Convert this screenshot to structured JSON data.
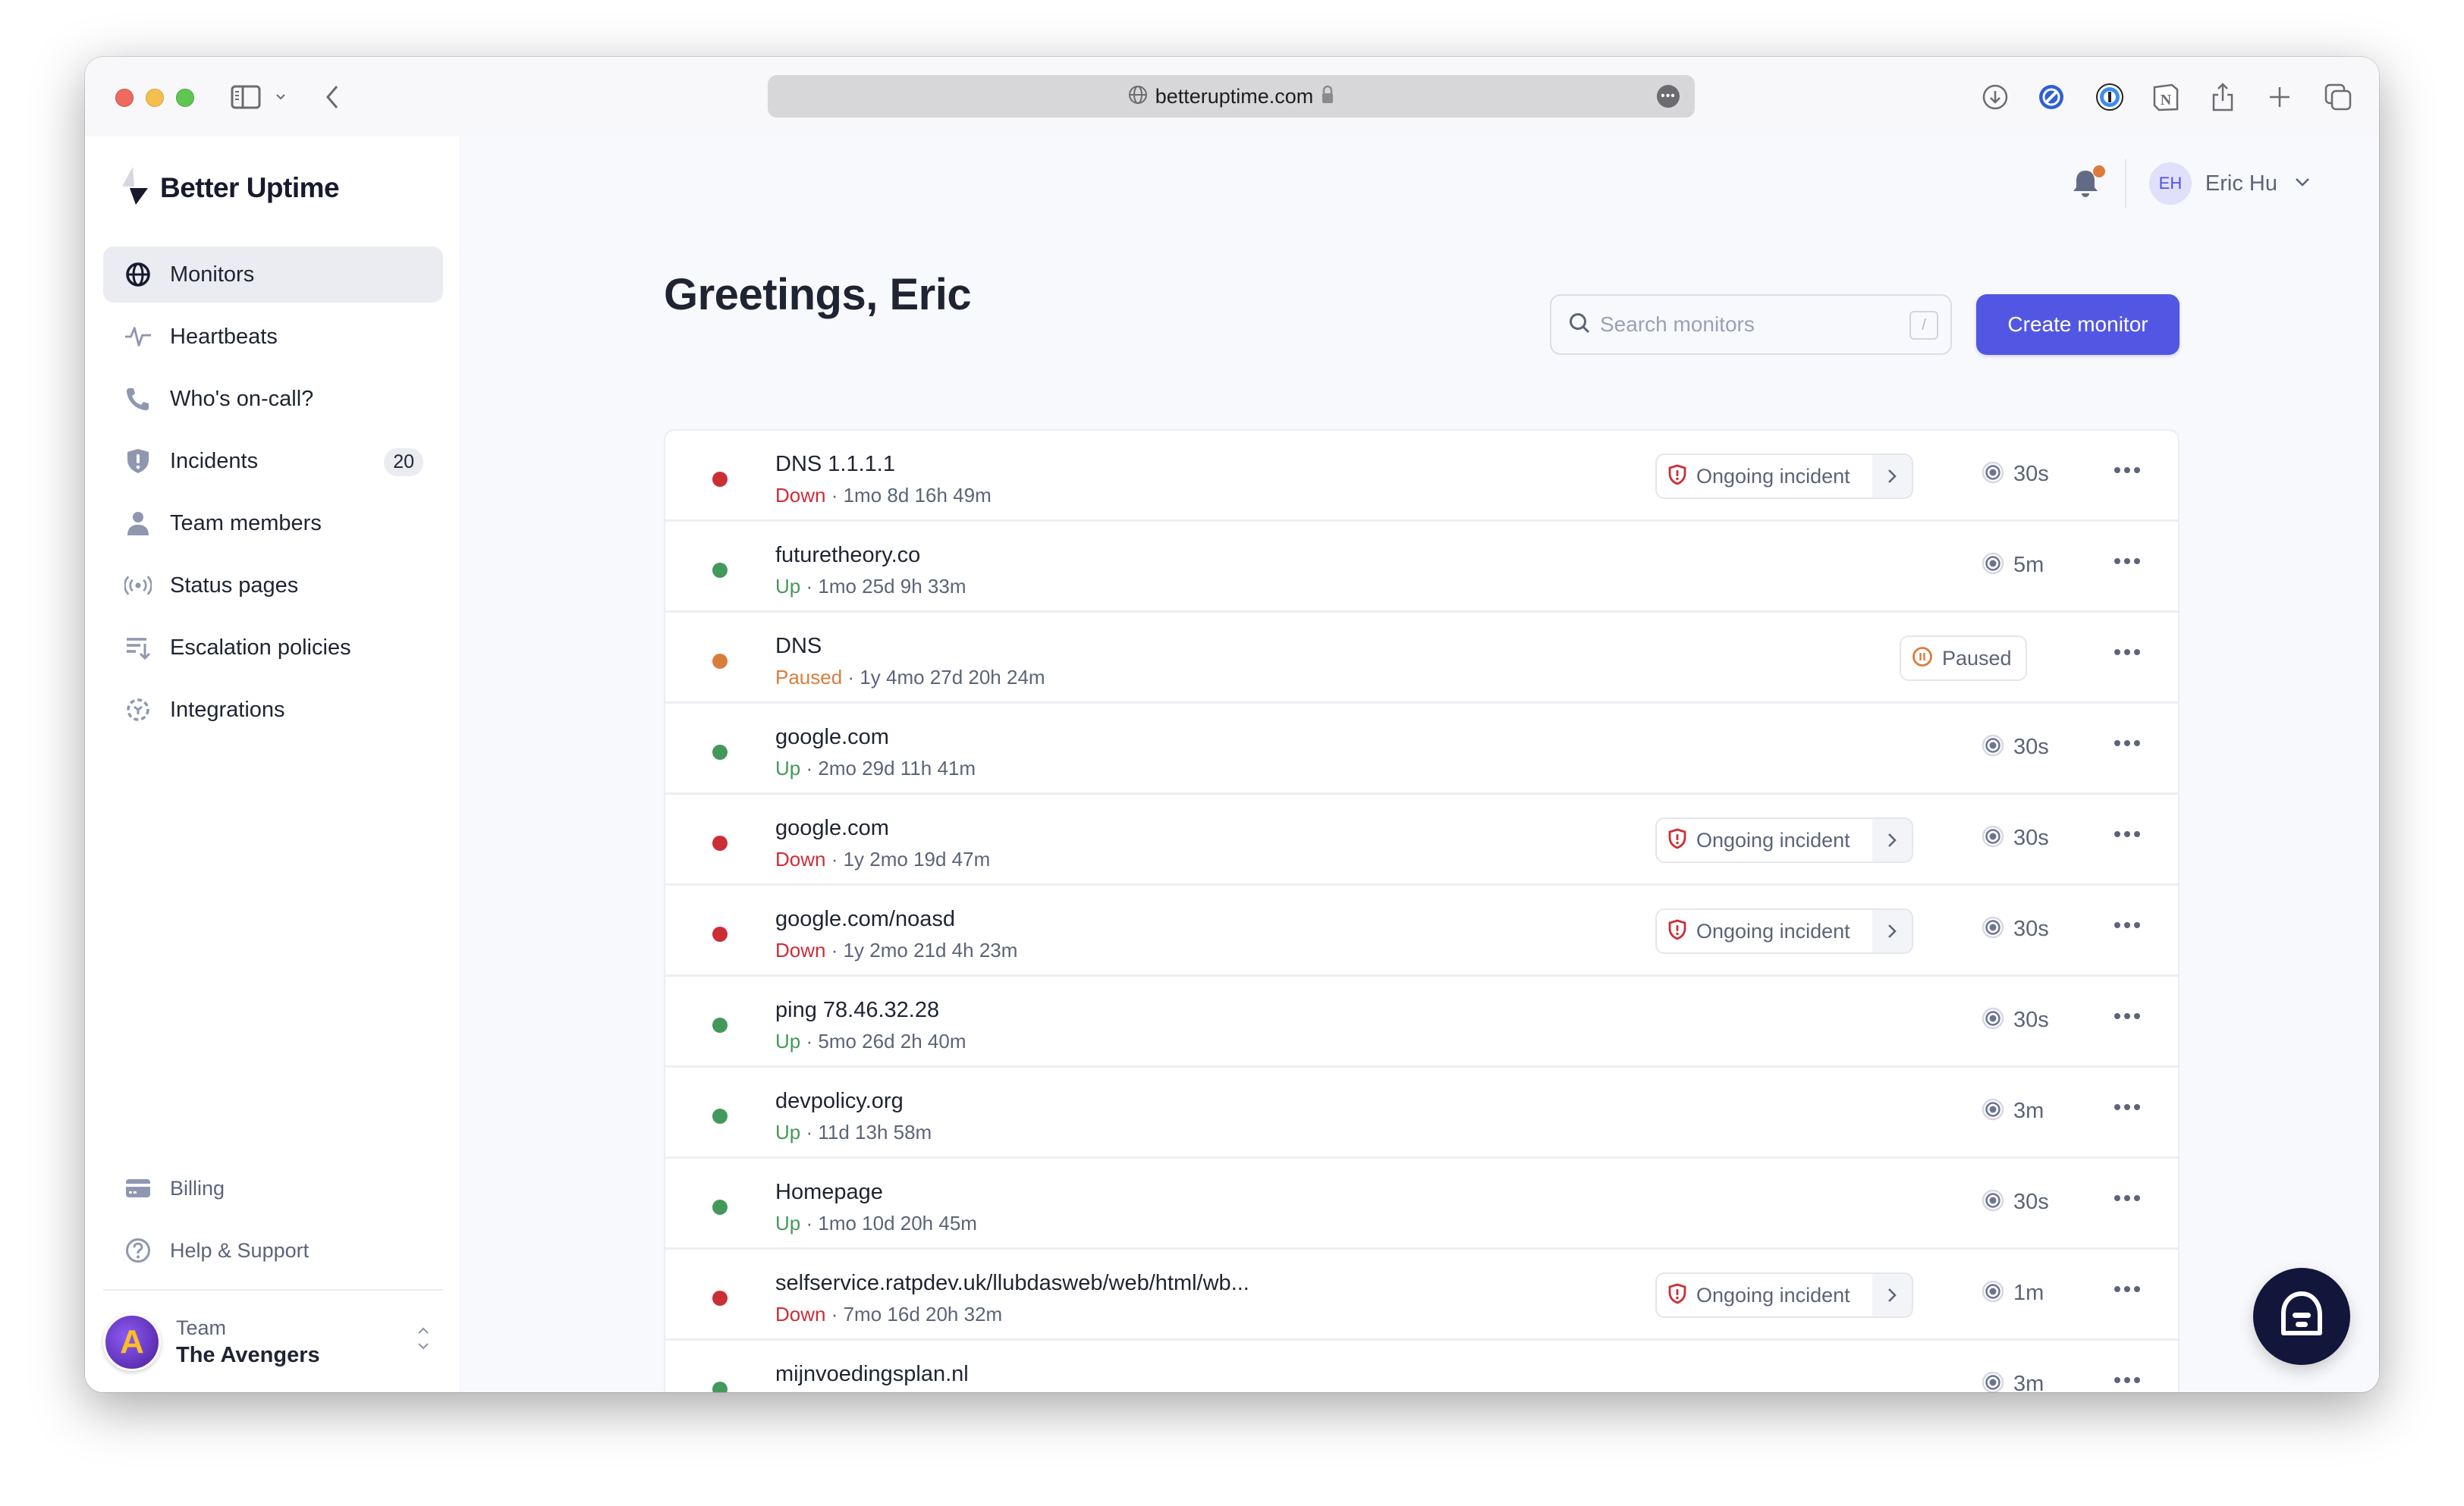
{
  "browser": {
    "url": "betteruptime.com",
    "toolbar_icons": [
      "download-icon",
      "adblock-icon",
      "password-manager-icon",
      "notion-icon",
      "share-icon",
      "new-tab-icon",
      "tabs-overview-icon"
    ]
  },
  "sidebar": {
    "brand": "Better Uptime",
    "items": [
      {
        "label": "Monitors",
        "icon": "globe-icon",
        "active": true
      },
      {
        "label": "Heartbeats",
        "icon": "pulse-icon"
      },
      {
        "label": "Who's on-call?",
        "icon": "phone-icon"
      },
      {
        "label": "Incidents",
        "icon": "shield-alert-icon",
        "badge": "20"
      },
      {
        "label": "Team members",
        "icon": "user-icon"
      },
      {
        "label": "Status pages",
        "icon": "broadcast-icon"
      },
      {
        "label": "Escalation policies",
        "icon": "escalation-icon"
      },
      {
        "label": "Integrations",
        "icon": "integrations-icon"
      }
    ],
    "bottom_items": [
      {
        "label": "Billing",
        "icon": "credit-card-icon"
      },
      {
        "label": "Help & Support",
        "icon": "help-circle-icon"
      }
    ],
    "team": {
      "label": "Team",
      "name": "The Avengers"
    }
  },
  "header": {
    "user_initials": "EH",
    "user_name": "Eric Hu",
    "notification_dot": true
  },
  "main": {
    "greeting": "Greetings, Eric",
    "search_placeholder": "Search monitors",
    "search_shortcut": "/",
    "create_label": "Create monitor",
    "incident_label": "Ongoing incident",
    "paused_label": "Paused",
    "monitors": [
      {
        "name": "DNS 1.1.1.1",
        "status": "Down",
        "duration": "1mo 8d 16h 49m",
        "incident": true,
        "frequency": "30s"
      },
      {
        "name": "futuretheory.co",
        "status": "Up",
        "duration": "1mo 25d 9h 33m",
        "incident": false,
        "frequency": "5m"
      },
      {
        "name": "DNS",
        "status": "Paused",
        "duration": "1y 4mo 27d 20h 24m",
        "incident": false,
        "frequency": ""
      },
      {
        "name": "google.com",
        "status": "Up",
        "duration": "2mo 29d 11h 41m",
        "incident": false,
        "frequency": "30s"
      },
      {
        "name": "google.com",
        "status": "Down",
        "duration": "1y 2mo 19d 47m",
        "incident": true,
        "frequency": "30s"
      },
      {
        "name": "google.com/noasd",
        "status": "Down",
        "duration": "1y 2mo 21d 4h 23m",
        "incident": true,
        "frequency": "30s"
      },
      {
        "name": "ping 78.46.32.28",
        "status": "Up",
        "duration": "5mo 26d 2h 40m",
        "incident": false,
        "frequency": "30s"
      },
      {
        "name": "devpolicy.org",
        "status": "Up",
        "duration": "11d 13h 58m",
        "incident": false,
        "frequency": "3m"
      },
      {
        "name": "Homepage",
        "status": "Up",
        "duration": "1mo 10d 20h 45m",
        "incident": false,
        "frequency": "30s"
      },
      {
        "name": "selfservice.ratpdev.uk/llubdasweb/web/html/wb...",
        "status": "Down",
        "duration": "7mo 16d 20h 32m",
        "incident": true,
        "frequency": "1m"
      },
      {
        "name": "mijnvoedingsplan.nl",
        "status": "Up",
        "duration": "",
        "incident": false,
        "frequency": "3m"
      }
    ]
  },
  "colors": {
    "accent": "#5257e3",
    "down": "#cc2e36",
    "up": "#43995b",
    "paused": "#d97d3d",
    "notification": "#de7c3d"
  }
}
